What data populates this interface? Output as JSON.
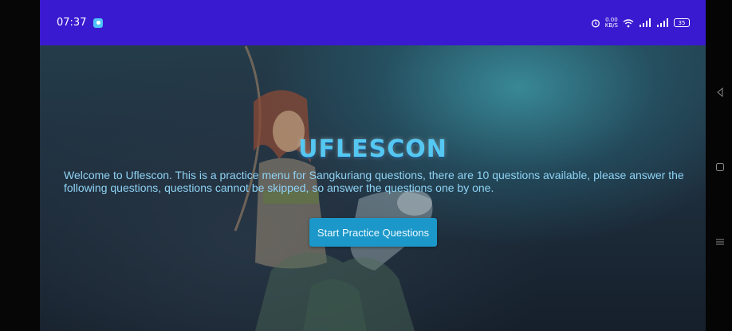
{
  "status_bar": {
    "time": "07:37",
    "net_speed_value": "0.00",
    "net_speed_unit": "KB/S",
    "battery": "35"
  },
  "main": {
    "title": "UFLESCON",
    "welcome_text": "Welcome to Uflescon. This is a practice menu for Sangkuriang questions, there are 10 questions available, please answer the following questions, questions cannot be skipped, so answer the questions one by one.",
    "start_button": "Start Practice Questions"
  },
  "colors": {
    "status_bar": "#3a1ad0",
    "title": "#55c8f2",
    "button": "#1b98c9",
    "welcome_text": "#8fd3f4"
  },
  "icons": [
    "app-notification-icon",
    "alarm-icon",
    "wifi-icon",
    "signal-icon",
    "battery-icon",
    "back-icon",
    "home-icon",
    "recents-icon"
  ]
}
